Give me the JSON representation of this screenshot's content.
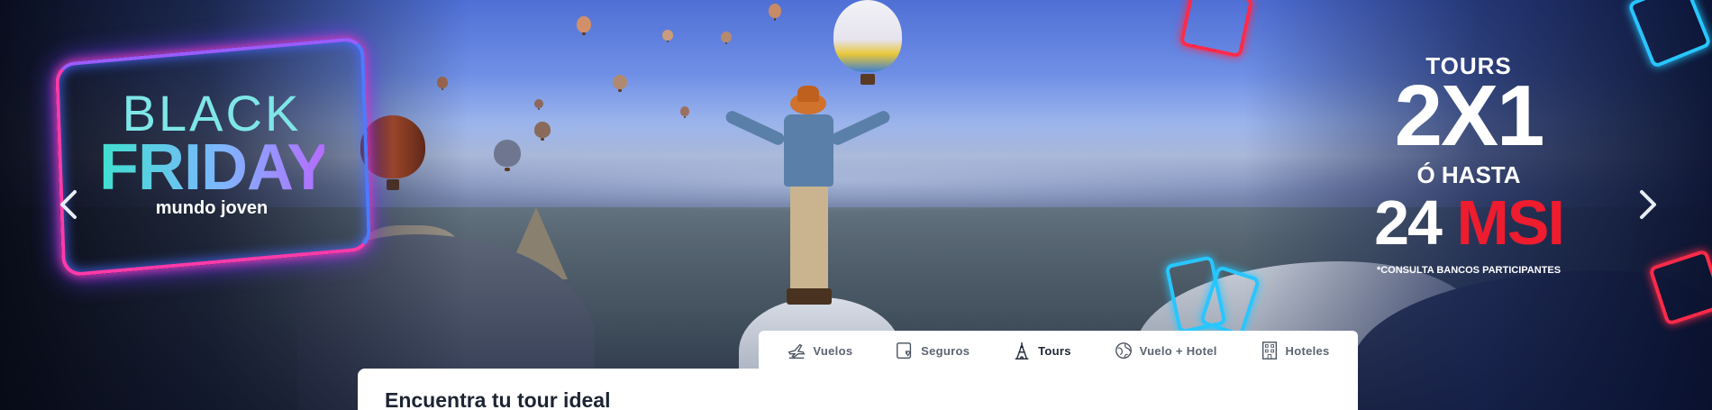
{
  "banner": {
    "black_label": "BLACK",
    "friday_label": "FRIDAY",
    "brand_label": "mundo joven",
    "promo": {
      "tours_label": "TOURS",
      "offer_label": "2X1",
      "hasta_label": "Ó HASTA",
      "msi_number": "24",
      "msi_label": "MSI",
      "fine_print": "*CONSULTA BANCOS PARTICIPANTES"
    },
    "colors": {
      "accent_red": "#ee1c2e",
      "neon_pink": "#ff3aa8",
      "neon_blue": "#28c6ff"
    }
  },
  "carousel": {
    "prev_icon": "chevron-left-icon",
    "next_icon": "chevron-right-icon"
  },
  "search_tabs": {
    "active": "Tours",
    "items": [
      {
        "label": "Vuelos",
        "icon": "plane-icon"
      },
      {
        "label": "Seguros",
        "icon": "insurance-icon"
      },
      {
        "label": "Tours",
        "icon": "eiffel-tower-icon"
      },
      {
        "label": "Vuelo + Hotel",
        "icon": "globe-icon"
      },
      {
        "label": "Hoteles",
        "icon": "building-icon"
      }
    ]
  },
  "search_panel": {
    "title": "Encuentra tu tour ideal"
  }
}
